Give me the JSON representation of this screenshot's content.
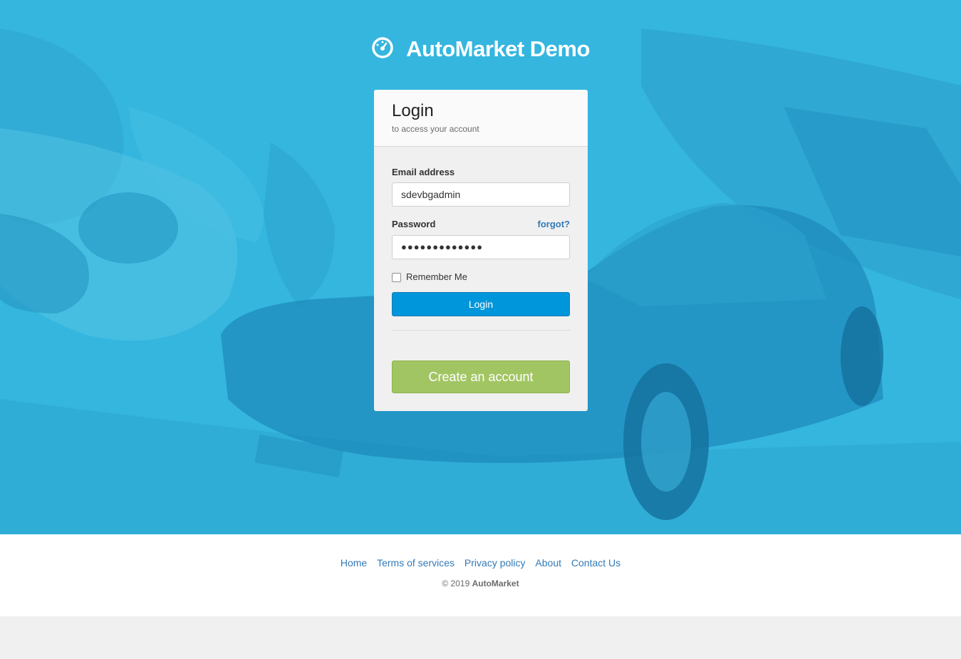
{
  "brand": {
    "title": "AutoMarket Demo",
    "logo_icon": "speedometer-icon",
    "color": "#ffffff"
  },
  "theme": {
    "hero_bg": "#34b6df",
    "login_button": "#0096db",
    "create_button": "#a2c563",
    "link": "#337ab7"
  },
  "login_card": {
    "title": "Login",
    "subtitle": "to access your account",
    "email": {
      "label": "Email address",
      "value": "sdevbgadmin"
    },
    "password": {
      "label": "Password",
      "value": "●●●●●●●●●●●●●",
      "forgot_label": "forgot?"
    },
    "remember": {
      "label": "Remember Me",
      "checked": false
    },
    "login_button": "Login",
    "create_account_button": "Create an account"
  },
  "footer": {
    "links": [
      "Home",
      "Terms of services",
      "Privacy policy",
      "About",
      "Contact Us"
    ],
    "copyright_prefix": "© 2019",
    "copyright_brand": "AutoMarket"
  }
}
